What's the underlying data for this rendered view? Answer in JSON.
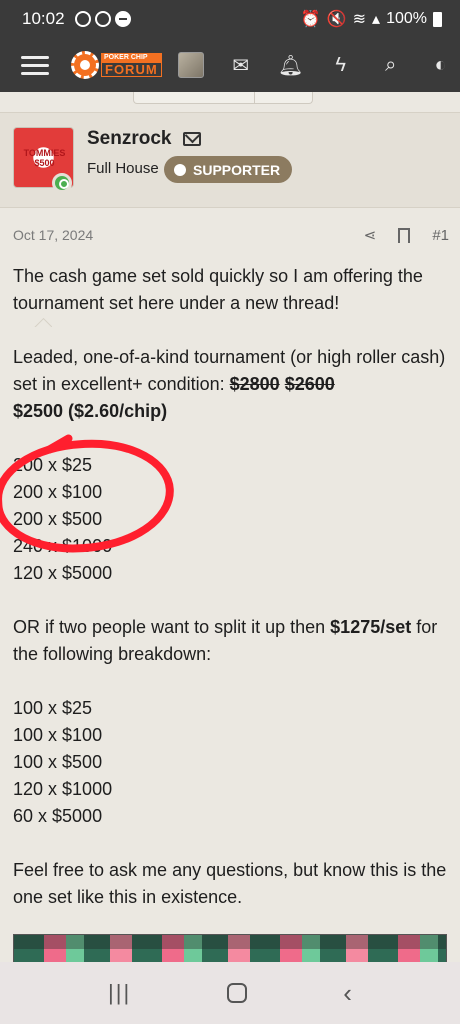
{
  "status_bar": {
    "time": "10:02",
    "battery": "100%"
  },
  "nav": {
    "logo_top": "POKER CHIP",
    "logo_bottom": "FORUM"
  },
  "post": {
    "username": "Senzrock",
    "user_title": "Full House",
    "badge": "SUPPORTER",
    "avatar_text": [
      "TOMMIES",
      "$500"
    ],
    "date": "Oct 17, 2024",
    "post_number": "#1",
    "paragraph1": "The cash game set sold quickly so I am offering the tournament set here under a new thread!",
    "paragraph2_text": "Leaded, one-of-a-kind tournament (or high roller cash) set in excellent+ condition: ",
    "old_price1": "$2800",
    "old_price2": "$2600",
    "new_price": "$2500 ($2.60/chip)",
    "list1": [
      "200 x $25",
      "200 x $100",
      "200 x $500",
      "240 x $1000",
      "120 x $5000"
    ],
    "paragraph3_text": "OR if two people want to split it up then ",
    "split_price": "$1275/set",
    "paragraph3_tail": " for the following breakdown:",
    "list2": [
      "100 x $25",
      "100 x $100",
      "100 x $500",
      "120 x $1000",
      "60 x $5000"
    ],
    "paragraph4": "Feel free to ask me any questions, but know this is the one set like this in existence."
  }
}
